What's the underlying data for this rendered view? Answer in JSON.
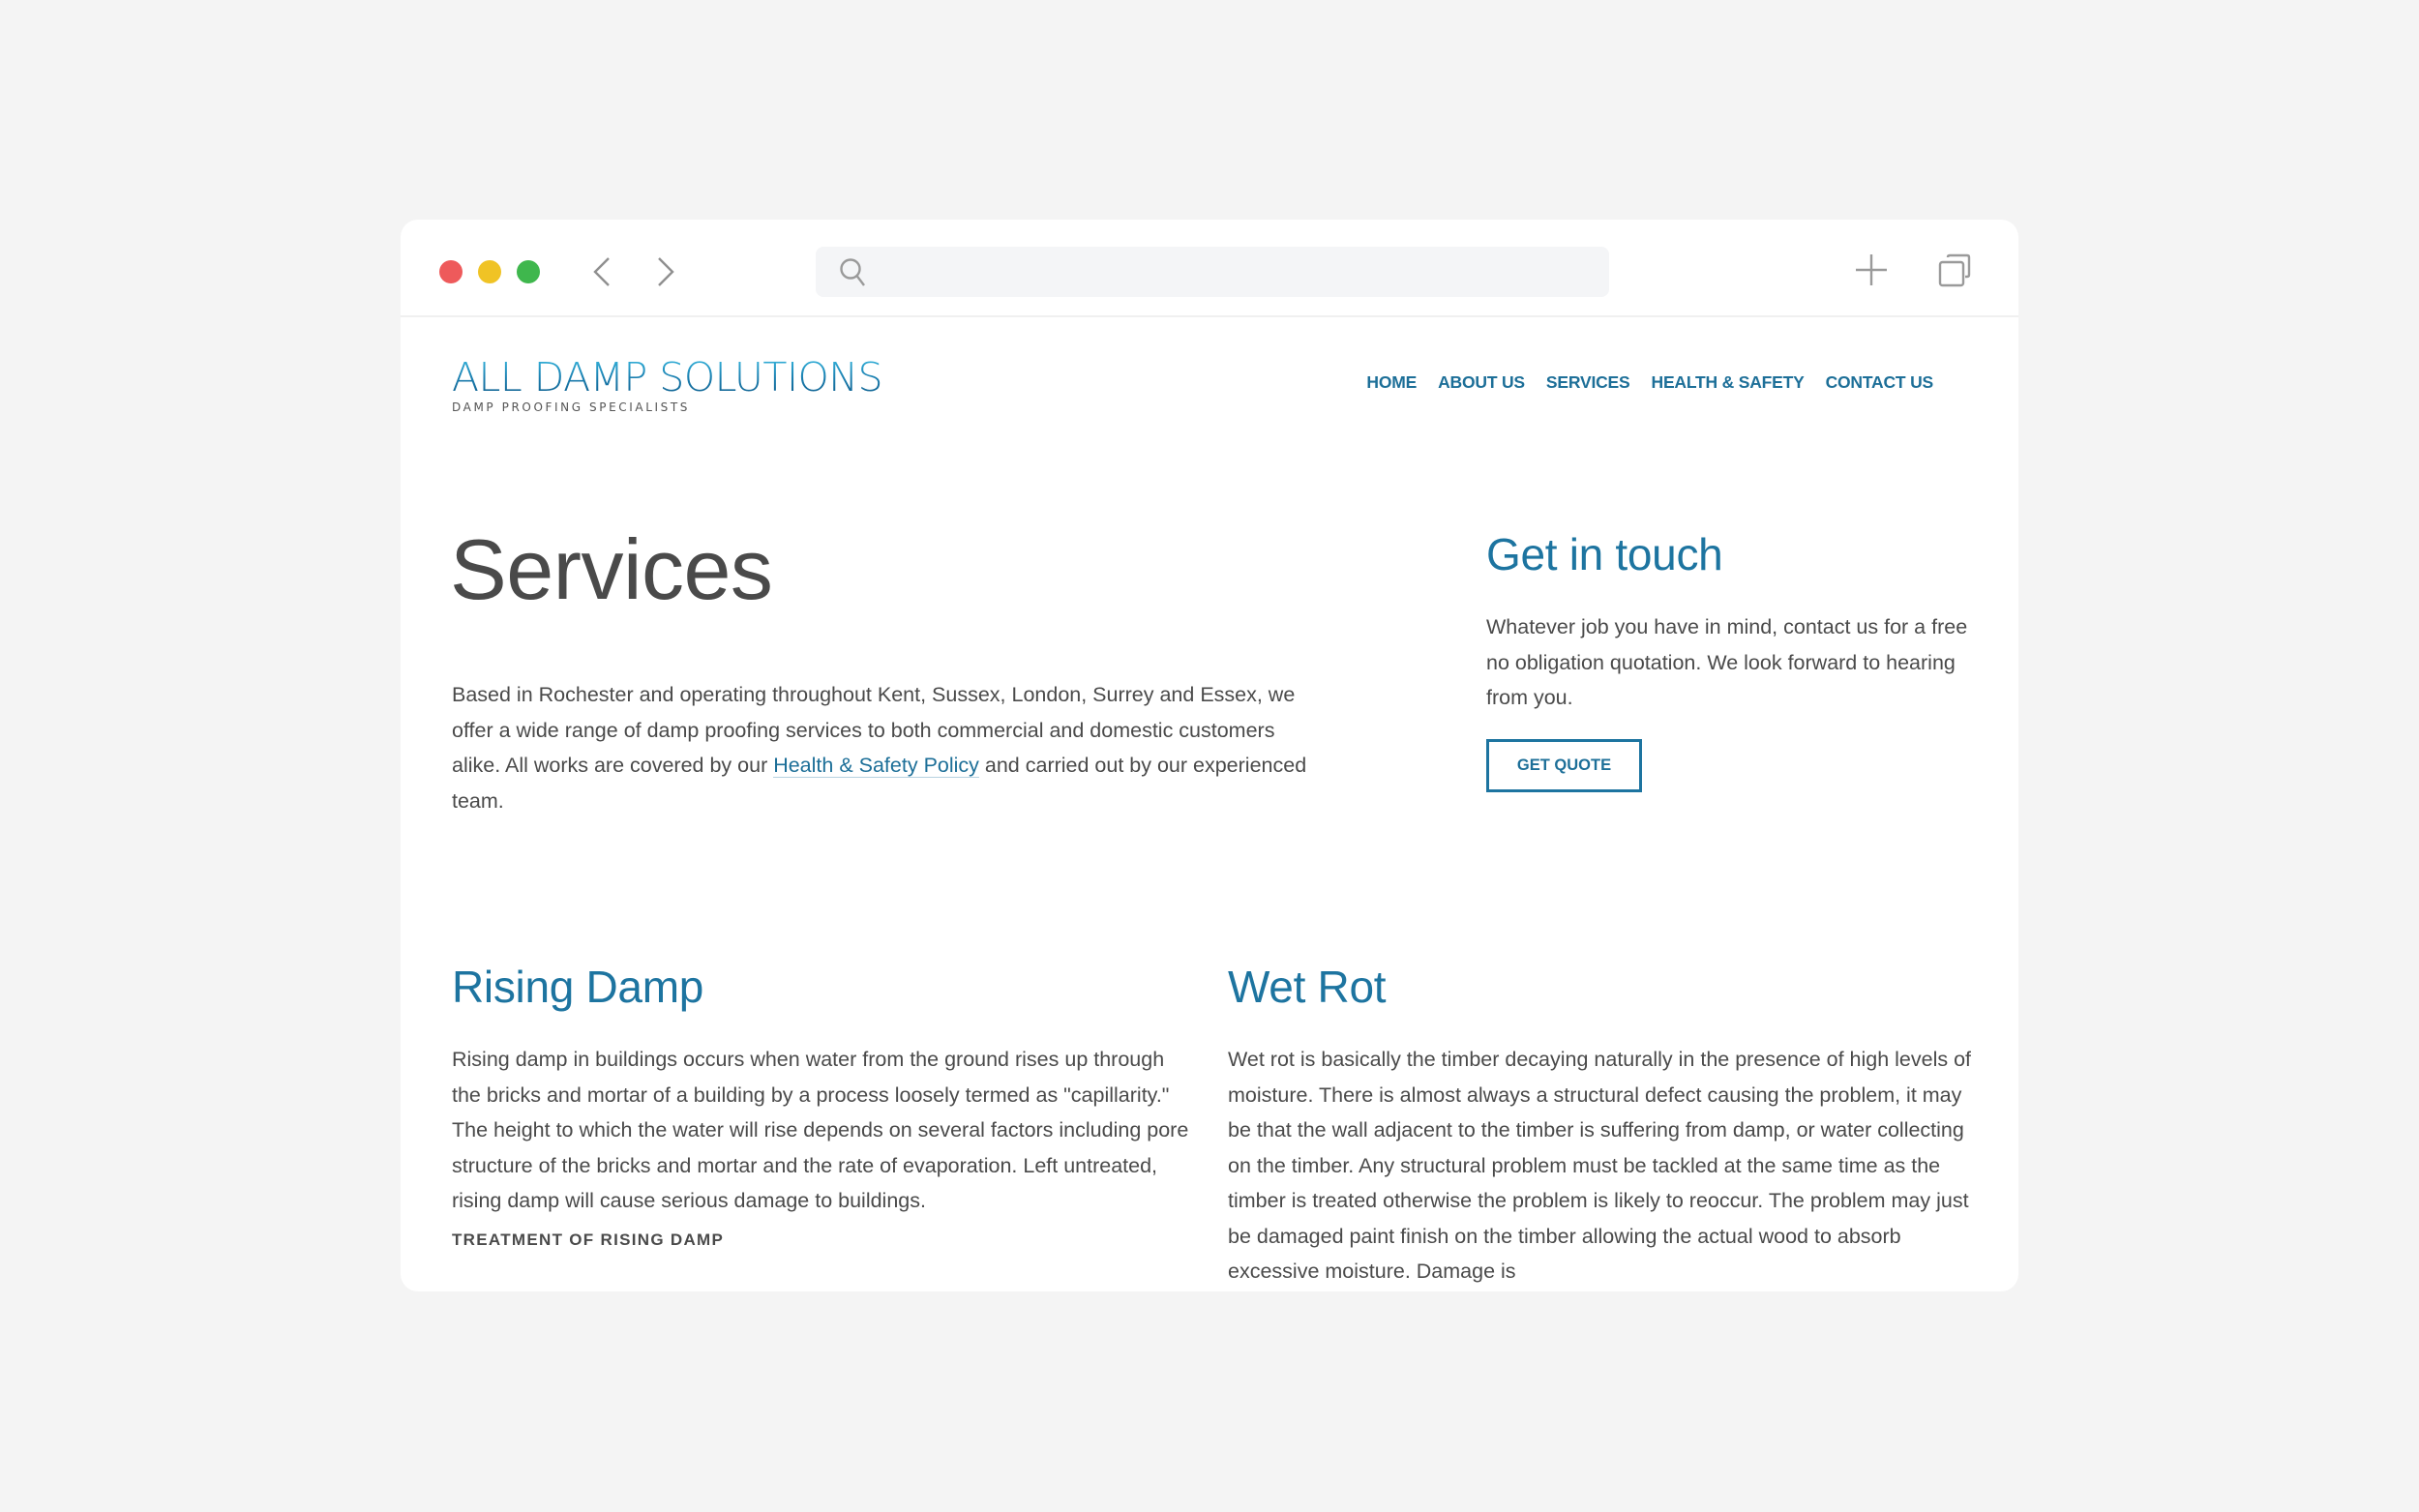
{
  "browser": {
    "traffic_lights": [
      {
        "name": "close",
        "color": "#ee5a5b"
      },
      {
        "name": "minimize",
        "color": "#f0c325"
      },
      {
        "name": "maximize",
        "color": "#3fb74d"
      }
    ],
    "back_icon": "chevron-left-icon",
    "forward_icon": "chevron-right-icon",
    "search": {
      "icon": "search-icon",
      "value": "",
      "placeholder": ""
    },
    "new_tab_icon": "plus-icon",
    "tabs_icon": "copy-icon"
  },
  "site": {
    "logo": {
      "title": "ALL DAMP SOLUTIONS",
      "tagline": "DAMP PROOFING SPECIALISTS"
    },
    "nav": [
      {
        "label": "HOME"
      },
      {
        "label": "ABOUT US"
      },
      {
        "label": "SERVICES"
      },
      {
        "label": "HEALTH & SAFETY"
      },
      {
        "label": "CONTACT US"
      }
    ],
    "accent_color": "#1d74a0",
    "text_color": "#4a4a4a"
  },
  "main": {
    "title": "Services",
    "intro": {
      "before_link": "Based in Rochester and operating throughout Kent, Sussex, London, Surrey and Essex, we offer a wide range of damp proofing services to both commercial and domestic customers alike. All works are covered by our ",
      "link_text": "Health & Safety Policy",
      "after_link": " and carried out by our experienced team."
    }
  },
  "aside": {
    "title": "Get in touch",
    "text": "Whatever job you have in mind, contact us for a free no obligation quotation. We look forward to hearing from you.",
    "button_label": "GET QUOTE"
  },
  "services": [
    {
      "title": "Rising Damp",
      "text": "Rising damp in buildings occurs when water from the ground rises up through the bricks and mortar of a building by a process loosely termed as \"capillarity.\" The height to which the water will rise depends on several factors including pore structure of the bricks and mortar and the rate of evaporation. Left untreated, rising damp will cause serious damage to buildings.",
      "subheading": "TREATMENT OF RISING DAMP"
    },
    {
      "title": "Wet Rot",
      "text": "Wet rot is basically the timber decaying naturally in the presence of high levels of moisture. There is almost always a structural defect causing the problem, it may be that the wall adjacent to the timber is suffering from damp, or water collecting on the timber. Any structural problem must be tackled at the same time as the timber is treated otherwise the problem is likely to reoccur. The problem may just be damaged paint finish on the timber allowing the actual wood to absorb excessive moisture. Damage is"
    }
  ]
}
